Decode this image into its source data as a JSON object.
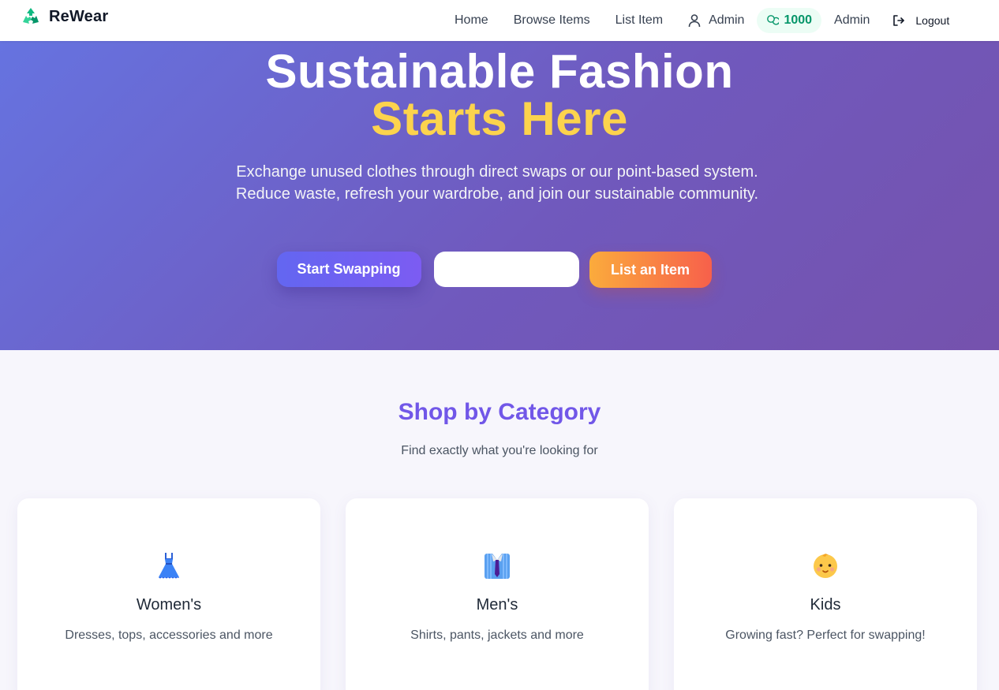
{
  "navbar": {
    "brand": "ReWear",
    "brand_icon": "recycle-icon",
    "links": [
      "Home",
      "Browse Items",
      "List Item"
    ],
    "user_name": "Admin",
    "user_icon": "user-icon",
    "points": "1000",
    "points_icon": "coins-icon",
    "admin_label": "Admin",
    "logout_label": "Logout",
    "logout_icon": "logout-icon"
  },
  "hero": {
    "title_line1": "Sustainable Fashion",
    "title_line2": "Starts Here",
    "subtitle": "Exchange unused clothes through direct swaps or our point-based system. Reduce waste, refresh your wardrobe, and join our sustainable community.",
    "primary_button": "Start Swapping",
    "secondary_button": "",
    "list_button": "List an Item",
    "accent_color": "#fcd34d"
  },
  "categories": {
    "title": "Shop by Category",
    "subtitle": "Find exactly what you're looking for",
    "items": [
      {
        "title": "Women's",
        "description": "Dresses, tops, accessories and more",
        "icon": "dress-icon"
      },
      {
        "title": "Men's",
        "description": "Shirts, pants, jackets and more",
        "icon": "shirt-tie-icon"
      },
      {
        "title": "Kids",
        "description": "Growing fast? Perfect for swapping!",
        "icon": "baby-face-icon"
      }
    ]
  }
}
